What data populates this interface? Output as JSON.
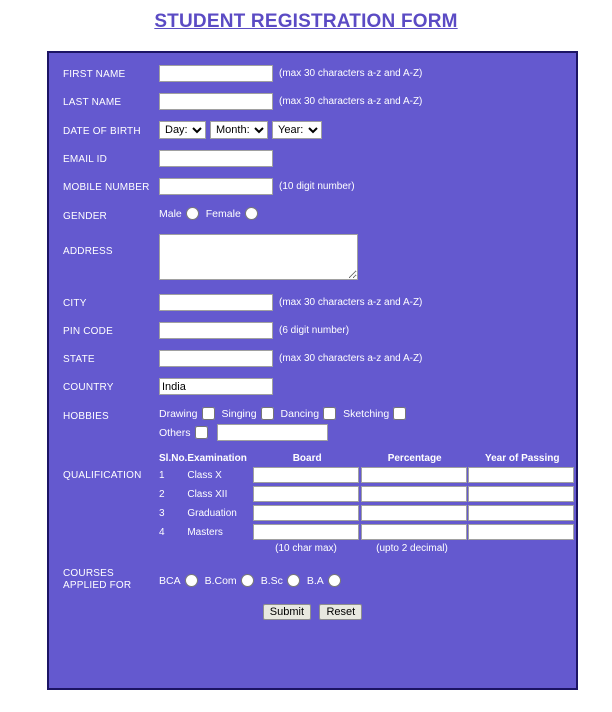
{
  "page": {
    "title": "STUDENT REGISTRATION FORM",
    "accent_color": "#5b4bc4",
    "panel_color": "#6459cf",
    "panel_border_color": "#1c1464"
  },
  "fields": {
    "first_name": {
      "label": "FIRST NAME",
      "value": "",
      "hint": "(max 30 characters a-z and A-Z)"
    },
    "last_name": {
      "label": "LAST NAME",
      "value": "",
      "hint": "(max 30 characters a-z and A-Z)"
    },
    "date_of_birth": {
      "label": "DATE OF BIRTH",
      "day_selected": "Day:",
      "month_selected": "Month:",
      "year_selected": "Year:"
    },
    "email_id": {
      "label": "EMAIL ID",
      "value": "",
      "hint": ""
    },
    "mobile_number": {
      "label": "MOBILE NUMBER",
      "value": "",
      "hint": "(10 digit number)"
    },
    "gender": {
      "label": "GENDER",
      "options": [
        "Male",
        "Female"
      ]
    },
    "address": {
      "label": "ADDRESS",
      "value": ""
    },
    "city": {
      "label": "CITY",
      "value": "",
      "hint": "(max 30 characters a-z and A-Z)"
    },
    "pin_code": {
      "label": "PIN CODE",
      "value": "",
      "hint": "(6 digit number)"
    },
    "state": {
      "label": "STATE",
      "value": "",
      "hint": "(max 30 characters a-z and A-Z)"
    },
    "country": {
      "label": "COUNTRY",
      "value": "India",
      "hint": ""
    },
    "hobbies": {
      "label": "HOBBIES",
      "options": [
        "Drawing",
        "Singing",
        "Dancing",
        "Sketching"
      ],
      "others_label": "Others",
      "others_value": ""
    },
    "qualification": {
      "label": "QUALIFICATION",
      "headers": [
        "Sl.No.",
        "Examination",
        "Board",
        "Percentage",
        "Year of Passing"
      ],
      "rows": [
        {
          "sl": "1",
          "exam": "Class X",
          "board": "",
          "percentage": "",
          "year": ""
        },
        {
          "sl": "2",
          "exam": "Class XII",
          "board": "",
          "percentage": "",
          "year": ""
        },
        {
          "sl": "3",
          "exam": "Graduation",
          "board": "",
          "percentage": "",
          "year": ""
        },
        {
          "sl": "4",
          "exam": "Masters",
          "board": "",
          "percentage": "",
          "year": ""
        }
      ],
      "board_hint": "(10 char max)",
      "percentage_hint": "(upto 2 decimal)",
      "year_hint": ""
    },
    "courses": {
      "label_line1": "COURSES",
      "label_line2": "APPLIED FOR",
      "options": [
        "BCA",
        "B.Com",
        "B.Sc",
        "B.A"
      ]
    }
  },
  "buttons": {
    "submit": "Submit",
    "reset": "Reset"
  }
}
